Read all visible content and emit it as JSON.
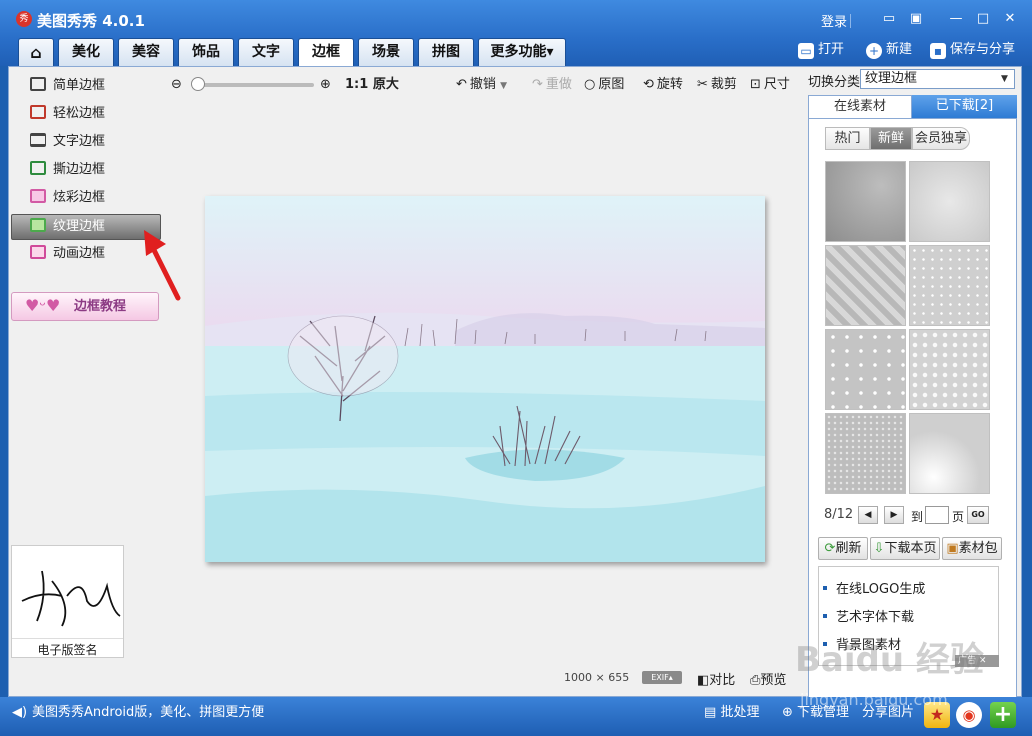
{
  "app": {
    "logo_text": "秀",
    "title": "美图秀秀 4.0.1"
  },
  "titlebar": {
    "login": "登录",
    "icons": [
      "speech-bubble-icon",
      "dropdown-icon",
      "minimize-icon",
      "maximize-icon",
      "close-icon"
    ]
  },
  "tabs": [
    {
      "label": "美化"
    },
    {
      "label": "美容"
    },
    {
      "label": "饰品"
    },
    {
      "label": "文字"
    },
    {
      "label": "边框"
    },
    {
      "label": "场景"
    },
    {
      "label": "拼图"
    },
    {
      "label": "更多功能▾"
    }
  ],
  "active_tab": "边框",
  "top_actions": {
    "open": "打开",
    "new": "新建",
    "save_share": "保存与分享"
  },
  "sidebar": {
    "items": [
      {
        "label": "简单边框"
      },
      {
        "label": "轻松边框"
      },
      {
        "label": "文字边框"
      },
      {
        "label": "撕边边框"
      },
      {
        "label": "炫彩边框"
      },
      {
        "label": "纹理边框"
      },
      {
        "label": "动画边框"
      }
    ],
    "selected": "纹理边框",
    "tutorial": "边框教程"
  },
  "toolbar": {
    "original_size": "1:1 原大",
    "undo": "撤销",
    "redo": "重做",
    "original": "原图",
    "rotate": "旋转",
    "crop": "裁剪",
    "size": "尺寸"
  },
  "canvas": {
    "dimensions": "1000 × 655",
    "exif": "EXIF▴",
    "compare": "对比",
    "preview": "预览"
  },
  "right_panel": {
    "category_label": "切换分类",
    "category_value": "纹理边框",
    "tabs": {
      "online": "在线素材",
      "downloaded": "已下载[2]"
    },
    "subtabs": {
      "hot": "热门",
      "fresh": "新鲜",
      "member": "会员独享"
    },
    "pagination": {
      "page": "8/12",
      "goto": "到",
      "page_unit": "页",
      "go": "GO"
    },
    "actions": {
      "refresh": "刷新",
      "download_page": "下载本页",
      "material_pack": "素材包"
    },
    "links": [
      "在线LOGO生成",
      "艺术字体下载",
      "背景图素材"
    ],
    "ad_label": "广告"
  },
  "signature": {
    "caption": "电子版签名"
  },
  "statusbar": {
    "promo": "美图秀秀Android版，美化、拼图更方便",
    "batch": "批处理",
    "download_manager": "下载管理",
    "share_image": "分享图片"
  },
  "watermark": {
    "baidu": "Baidu 经验",
    "url": "jingyan.baidu.com"
  },
  "colors": {
    "title_blue": "#2a6fc9",
    "panel_blue": "#2e7bd4",
    "accent_pink": "#d25aa4",
    "annotation_red": "#e01f1f"
  }
}
